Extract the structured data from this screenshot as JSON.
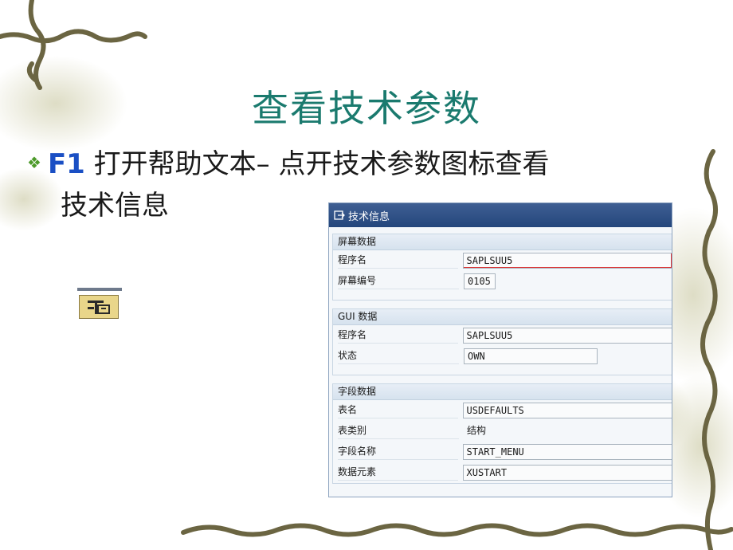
{
  "slide": {
    "title": "查看技术参数",
    "bullet_f1": "F1",
    "bullet_text_1": " 打开帮助文本– 点开技术参数图标查看",
    "bullet_text_2": "技术信息"
  },
  "icon": {
    "name": "technical-info-icon"
  },
  "dialog": {
    "title": "技术信息",
    "screen_data": {
      "header": "屏幕数据",
      "program_label": "程序名",
      "program_value": "SAPLSUU5",
      "screen_no_label": "屏幕编号",
      "screen_no_value": "0105"
    },
    "gui_data": {
      "header": "GUI 数据",
      "program_label": "程序名",
      "program_value": "SAPLSUU5",
      "status_label": "状态",
      "status_value": "OWN"
    },
    "field_data": {
      "header": "字段数据",
      "table_label": "表名",
      "table_value": "USDEFAULTS",
      "table_type_label": "表类别",
      "table_type_value": "结构",
      "field_name_label": "字段名称",
      "field_name_value": "START_MENU",
      "data_element_label": "数据元素",
      "data_element_value": "XUSTART"
    }
  },
  "colors": {
    "title": "#1a7a6e",
    "f1": "#1a4fc4",
    "vine": "#6b6542",
    "sap_titlebar": "#2f5186"
  }
}
